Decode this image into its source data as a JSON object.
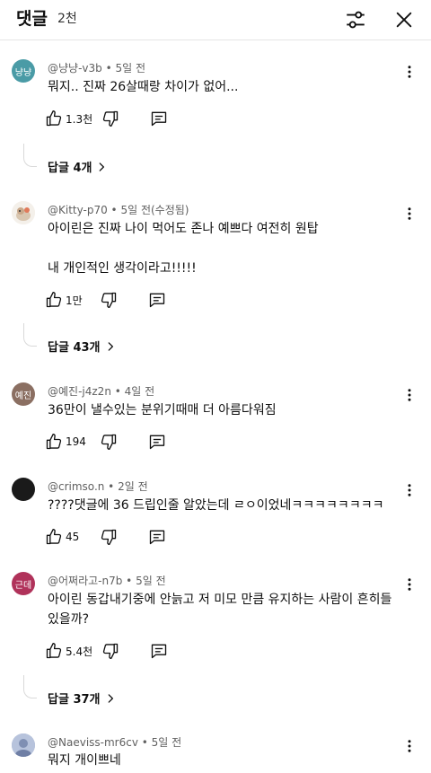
{
  "header": {
    "title": "댓글",
    "count": "2천"
  },
  "colors": {
    "avatar_1": "#4a9ba6",
    "avatar_3": "#8b6f62",
    "avatar_4": "#1a1a1a",
    "avatar_5": "#b0325a",
    "avatar_6": "#9aa8c8"
  },
  "comments": [
    {
      "avatar_text": "냥냥",
      "author": "@냥냥-v3b",
      "time": "5일 전",
      "text": "뭐지.. 진짜 26살때랑 차이가 없어...",
      "likes": "1.3천",
      "replies": "답글 4개"
    },
    {
      "avatar_text": "",
      "author": "@Kitty-p70",
      "time": "5일 전(수정됨)",
      "text_line1": "아이린은 진짜 나이 먹어도 존나 예쁘다 여전히 원탑",
      "text_line2": "내 개인적인 생각이라고!!!!!",
      "likes": "1만",
      "replies": "답글 43개"
    },
    {
      "avatar_text": "예진",
      "author": "@예진-j4z2n",
      "time": "4일 전",
      "text": "36만이 낼수있는 분위기때매 더 아름다워짐",
      "likes": "194"
    },
    {
      "avatar_text": "",
      "author": "@crimso.n",
      "time": "2일 전",
      "text": "????댓글에 36 드립인줄 알았는데 ㄹㅇ이었네ㅋㅋㅋㅋㅋㅋㅋㅋ",
      "likes": "45"
    },
    {
      "avatar_text": "근데",
      "author": "@어쩌라고-n7b",
      "time": "5일 전",
      "text_line1": "아이린 동갑내기중에 안늙고 저 미모 만큼 유지하는 사람이 흔히들",
      "text_line2": "있을까?",
      "likes": "5.4천",
      "replies": "답글 37개"
    },
    {
      "avatar_text": "",
      "author": "@Naeviss-mr6cv",
      "time": "5일 전",
      "text": "뭐지 개이쁘네"
    }
  ],
  "separator": " • ",
  "icons": {
    "filter": "sliders-icon",
    "close": "close-icon",
    "more": "more-vertical-icon",
    "like": "thumbs-up-icon",
    "dislike": "thumbs-down-icon",
    "reply": "comment-icon",
    "chevron": "chevron-right-icon"
  }
}
